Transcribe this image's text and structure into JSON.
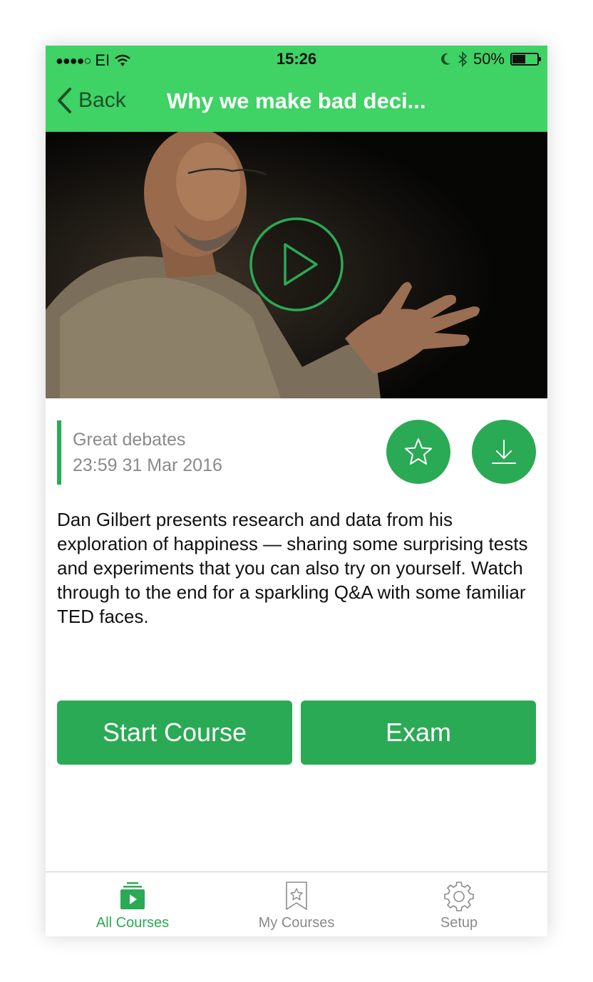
{
  "status_bar": {
    "carrier": "EI",
    "time": "15:26",
    "battery": "50%",
    "battery_level": 0.5
  },
  "nav": {
    "back_label": "Back",
    "title": "Why we make bad deci..."
  },
  "course": {
    "category": "Great debates",
    "datetime": "23:59 31 Mar 2016",
    "description": "Dan Gilbert presents research and data from his exploration of happiness — sharing some surprising tests and experiments that you can also try on yourself. Watch through to the end for a sparkling Q&A with some familiar TED faces."
  },
  "actions": {
    "start_label": "Start Course",
    "exam_label": "Exam"
  },
  "tabs": [
    {
      "label": "All Courses",
      "icon": "play-folder-icon",
      "active": true
    },
    {
      "label": "My Courses",
      "icon": "bookmark-star-icon",
      "active": false
    },
    {
      "label": "Setup",
      "icon": "gear-icon",
      "active": false
    }
  ],
  "colors": {
    "header_green": "#3fd265",
    "accent_green": "#2aaa54",
    "muted_text": "#8a8a8a"
  }
}
